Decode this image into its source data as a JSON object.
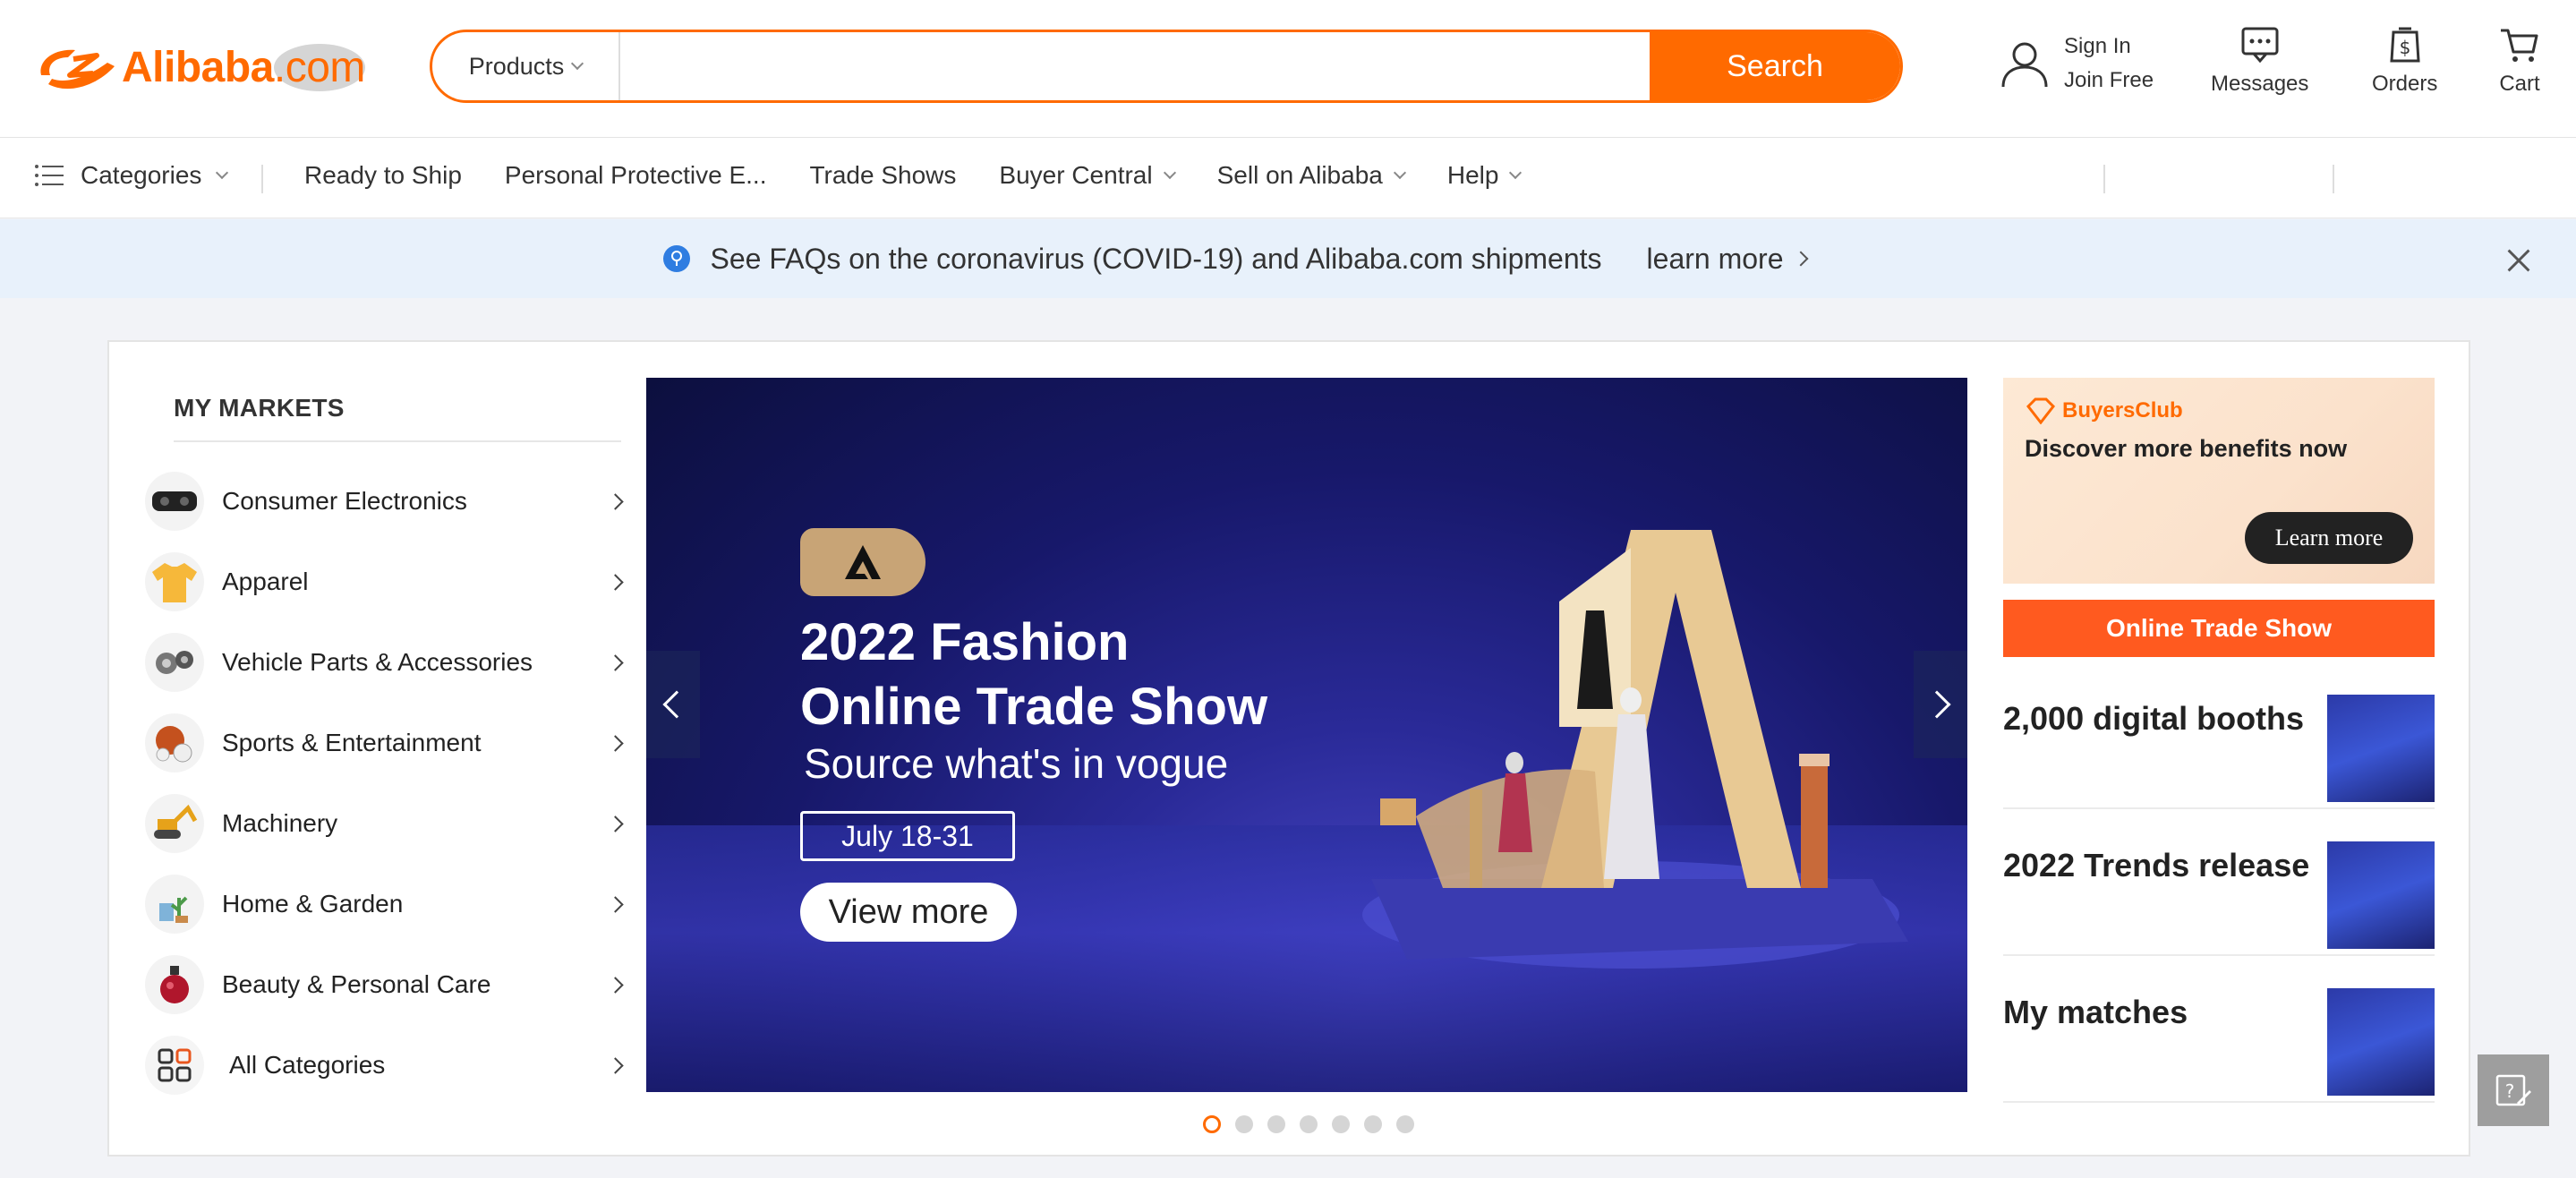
{
  "header": {
    "logo_brand": "Alibaba",
    "logo_suffix": ".com",
    "search": {
      "category": "Products",
      "placeholder": "",
      "button": "Search"
    },
    "sign_in": "Sign In",
    "join_free": "Join Free",
    "messages": "Messages",
    "orders": "Orders",
    "cart": "Cart"
  },
  "nav": {
    "categories": "Categories",
    "items": [
      {
        "label": "Ready to Ship",
        "dropdown": false
      },
      {
        "label": "Personal Protective E...",
        "dropdown": false
      },
      {
        "label": "Trade Shows",
        "dropdown": false
      },
      {
        "label": "Buyer Central",
        "dropdown": true
      },
      {
        "label": "Sell on Alibaba",
        "dropdown": true
      },
      {
        "label": "Help",
        "dropdown": true
      }
    ]
  },
  "notice": {
    "text": "See FAQs on the coronavirus (COVID-19) and Alibaba.com shipments",
    "link": "learn more"
  },
  "markets": {
    "title": "MY MARKETS",
    "items": [
      {
        "label": "Consumer Electronics",
        "icon": "vr-headset-icon"
      },
      {
        "label": "Apparel",
        "icon": "tshirt-icon"
      },
      {
        "label": "Vehicle Parts & Accessories",
        "icon": "vehicle-parts-icon"
      },
      {
        "label": "Sports & Entertainment",
        "icon": "sports-balls-icon"
      },
      {
        "label": "Machinery",
        "icon": "excavator-icon"
      },
      {
        "label": "Home & Garden",
        "icon": "home-garden-icon"
      },
      {
        "label": "Beauty & Personal Care",
        "icon": "perfume-icon"
      },
      {
        "label": "All Categories",
        "icon": "grid-icon"
      }
    ]
  },
  "banner": {
    "title_line1": "2022 Fashion",
    "title_line2": "Online Trade Show",
    "subtitle": "Source what's in vogue",
    "date": "July 18-31",
    "cta": "View more",
    "slide_count": 7,
    "active_slide": 0
  },
  "side": {
    "buyers_club_brand": "BuyersClub",
    "buyers_club_title": "Discover more benefits now",
    "buyers_club_button": "Learn more",
    "online_trade_show": "Online Trade Show",
    "items": [
      {
        "label": "2,000 digital booths"
      },
      {
        "label": "2022 Trends release"
      },
      {
        "label": "My matches"
      }
    ]
  },
  "colors": {
    "brand": "#ff6a00",
    "notice_bg": "#e8f1fb",
    "page_bg": "#f2f3f7"
  }
}
